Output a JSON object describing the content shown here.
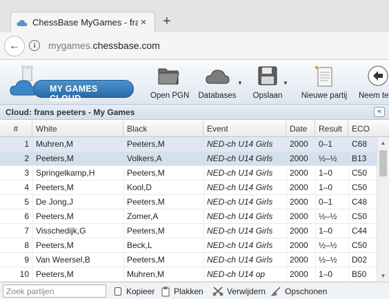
{
  "browser": {
    "tab_title": "ChessBase MyGames - fran",
    "close_glyph": "×",
    "new_tab_glyph": "+",
    "back_glyph": "←",
    "info_glyph": "i",
    "url_prefix": "mygames.",
    "url_host": "chessbase.com"
  },
  "app": {
    "logo_text": "MY GAMES CLOUD",
    "toolbar": {
      "open_pgn": "Open PGN",
      "databases": "Databases",
      "save": "Opslaan",
      "new_game": "Nieuwe partij",
      "take_back": "Neem terug"
    }
  },
  "panel": {
    "title": "Cloud: frans peeters - My Games",
    "collapse_glyph": "«"
  },
  "table": {
    "columns": [
      "#",
      "White",
      "Black",
      "Event",
      "Date",
      "Result",
      "ECO"
    ],
    "rows": [
      {
        "n": "1",
        "white": "Muhren,M",
        "black": "Peeters,M",
        "event": "NED-ch U14 Girls",
        "date": "2000",
        "result": "0–1",
        "eco": "C68"
      },
      {
        "n": "2",
        "white": "Peeters,M",
        "black": "Volkers,A",
        "event": "NED-ch U14 Girls",
        "date": "2000",
        "result": "½–½",
        "eco": "B13"
      },
      {
        "n": "3",
        "white": "Springelkamp,H",
        "black": "Peeters,M",
        "event": "NED-ch U14 Girls",
        "date": "2000",
        "result": "1–0",
        "eco": "C50"
      },
      {
        "n": "4",
        "white": "Peeters,M",
        "black": "Kool,D",
        "event": "NED-ch U14 Girls",
        "date": "2000",
        "result": "1–0",
        "eco": "C50"
      },
      {
        "n": "5",
        "white": "De Jong,J",
        "black": "Peeters,M",
        "event": "NED-ch U14 Girls",
        "date": "2000",
        "result": "0–1",
        "eco": "C48"
      },
      {
        "n": "6",
        "white": "Peeters,M",
        "black": "Zomer,A",
        "event": "NED-ch U14 Girls",
        "date": "2000",
        "result": "½–½",
        "eco": "C50"
      },
      {
        "n": "7",
        "white": "Visschedijk,G",
        "black": "Peeters,M",
        "event": "NED-ch U14 Girls",
        "date": "2000",
        "result": "1–0",
        "eco": "C44"
      },
      {
        "n": "8",
        "white": "Peeters,M",
        "black": "Beck,L",
        "event": "NED-ch U14 Girls",
        "date": "2000",
        "result": "½–½",
        "eco": "C50"
      },
      {
        "n": "9",
        "white": "Van Weersel,B",
        "black": "Peeters,M",
        "event": "NED-ch U14 Girls",
        "date": "2000",
        "result": "½–½",
        "eco": "D02"
      },
      {
        "n": "10",
        "white": "Peeters,M",
        "black": "Muhren,M",
        "event": "NED-ch U14 op",
        "date": "2000",
        "result": "1–0",
        "eco": "B50"
      }
    ]
  },
  "bottom": {
    "search_placeholder": "Zoek partijen",
    "copy": "Kopieer",
    "paste": "Plakken",
    "delete": "Verwijdern",
    "clean": "Opschonen"
  },
  "colors": {
    "accent": "#2a6ba9",
    "selected_row": "#dfe8f2"
  },
  "icons": [
    "cloud-favicon-icon",
    "back-arrow-icon",
    "info-icon",
    "folder-icon",
    "cloud-icon",
    "floppy-disk-icon",
    "new-document-icon",
    "undo-arrow-icon",
    "copy-icon",
    "clipboard-icon",
    "scissors-icon",
    "broom-icon"
  ]
}
